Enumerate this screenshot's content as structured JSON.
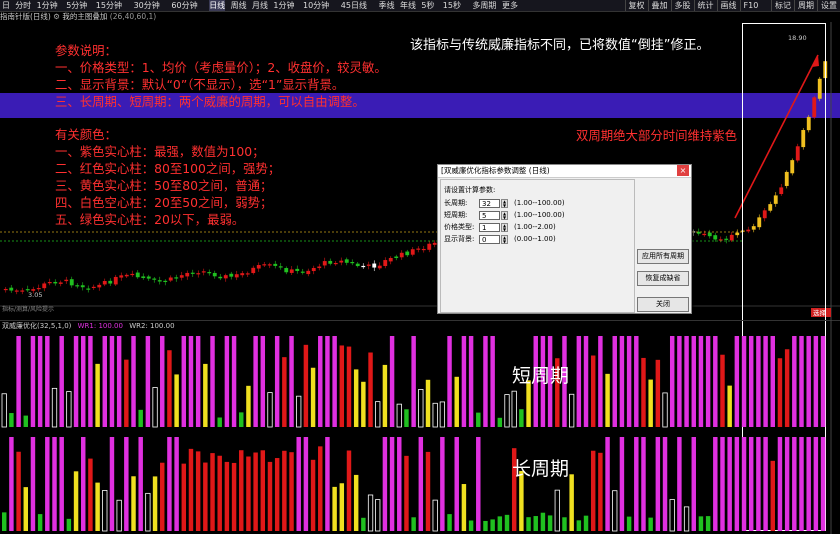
{
  "toolbar": {
    "left_items": [
      "日",
      "分时",
      "1分钟",
      "5分钟",
      "15分钟",
      "30分钟",
      "60分钟",
      "日线",
      "周线",
      "月线",
      "1分钟",
      "10分钟",
      "45日线",
      "季线",
      "年线",
      "5秒",
      "15秒",
      "多周期",
      "更多"
    ],
    "active_item": "日线",
    "right_items": [
      "复权",
      "叠加",
      "多股",
      "统计",
      "画线",
      "F10",
      "标记",
      "周期",
      "设置"
    ]
  },
  "subheader": {
    "title": "指南针版(日线)",
    "indicator": "我的主图叠加",
    "params": "(26,40,60,1)"
  },
  "annotations": {
    "params_lines": [
      "参数说明：",
      "一、价格类型：1、均价（考虑量价）；2、收盘价，较灵敏。",
      "二、显示背景：默认“0”（不显示），选“1”显示背景。",
      "三、长周期、短周期：两个威廉的周期，可以自由调整。"
    ],
    "color_lines": [
      "有关颜色：",
      "一、紫色实心柱：最强，数值为100；",
      "二、红色实心柱：80至100之间，强势；",
      "三、黄色实心柱：50至80之间，普通；",
      "四、白色空心柱：20至50之间，弱势；",
      "五、绿色实心柱：20以下，最弱。"
    ],
    "top_note": "该指标与传统威廉指标不同，已将数值“倒挂”修正。",
    "right_note": "双周期绝大部分时间维持紫色",
    "short_label": "短周期",
    "long_label": "长周期"
  },
  "main_chart": {
    "price_high_label": "18.90",
    "price_low_label": "3.05",
    "footer_left": "指标/测算/风险提示",
    "axis_right_badge": "选择"
  },
  "subchart": {
    "indicator": "双威廉优化(32,5,1,0)",
    "wr1_label": "WR1: 100.00",
    "wr2_label": "WR2: 100.00"
  },
  "dialog": {
    "title": "[双威廉优化指标参数调整 (日线)",
    "close_symbol": "×",
    "prompt": "请设置计算参数:",
    "params": [
      {
        "label": "长周期:",
        "value": "32",
        "range": "(1.00--100.00)"
      },
      {
        "label": "短周期:",
        "value": "5",
        "range": "(1.00--100.00)"
      },
      {
        "label": "价格类型:",
        "value": "1",
        "range": "(1.00--2.00)"
      },
      {
        "label": "显示背景:",
        "value": "0",
        "range": "(0.00--1.00)"
      }
    ],
    "buttons": {
      "apply_all": "应用所有周期",
      "restore": "恢复成缺省",
      "close": "关闭"
    }
  },
  "colors": {
    "magenta": "#e030e0",
    "red": "#e01818",
    "yellow": "#f0e020",
    "green": "#20c020",
    "band": "#3a1cb5"
  }
}
